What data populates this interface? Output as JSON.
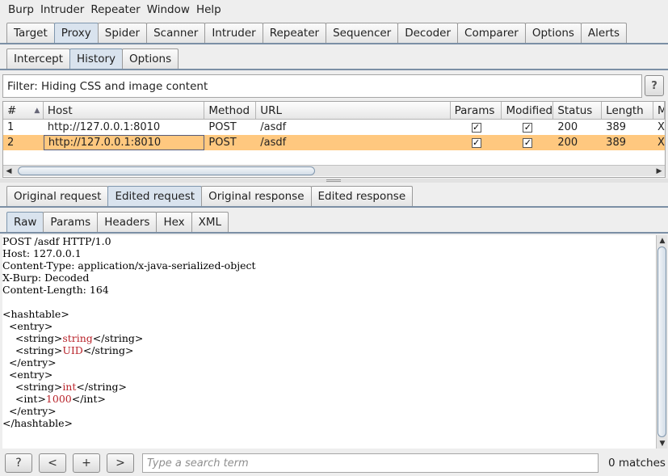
{
  "menu": [
    "Burp",
    "Intruder",
    "Repeater",
    "Window",
    "Help"
  ],
  "main_tabs": [
    "Target",
    "Proxy",
    "Spider",
    "Scanner",
    "Intruder",
    "Repeater",
    "Sequencer",
    "Decoder",
    "Comparer",
    "Options",
    "Alerts"
  ],
  "main_tabs_active": "Proxy",
  "proxy_tabs": [
    "Intercept",
    "History",
    "Options"
  ],
  "proxy_tabs_active": "History",
  "filter": {
    "text": "Filter: Hiding CSS and image content",
    "help_label": "?"
  },
  "table": {
    "columns": [
      "#",
      "Host",
      "Method",
      "URL",
      "Params",
      "Modified",
      "Status",
      "Length",
      "M"
    ],
    "sort_indicator": "▲",
    "rows": [
      {
        "num": "1",
        "host": "http://127.0.0.1:8010",
        "method": "POST",
        "url": "/asdf",
        "params": true,
        "modified": true,
        "status": "200",
        "length": "389",
        "extra": "X"
      },
      {
        "num": "2",
        "host": "http://127.0.0.1:8010",
        "method": "POST",
        "url": "/asdf",
        "params": true,
        "modified": true,
        "status": "200",
        "length": "389",
        "extra": "X"
      }
    ],
    "selected_row": 1,
    "scroll_left_arrow": "◀",
    "scroll_right_arrow": "▶"
  },
  "message_tabs": [
    "Original request",
    "Edited request",
    "Original response",
    "Edited response"
  ],
  "message_tabs_active": "Edited request",
  "view_tabs": [
    "Raw",
    "Params",
    "Headers",
    "Hex",
    "XML"
  ],
  "view_tabs_active": "Raw",
  "editor": {
    "lines": [
      [
        {
          "t": "POST /asdf HTTP/1.0"
        }
      ],
      [
        {
          "t": "Host: 127.0.0.1"
        }
      ],
      [
        {
          "t": "Content-Type: application/x-java-serialized-object"
        }
      ],
      [
        {
          "t": "X-Burp: Decoded"
        }
      ],
      [
        {
          "t": "Content-Length: 164"
        }
      ],
      [
        {
          "t": ""
        }
      ],
      [
        {
          "t": "<hashtable>"
        }
      ],
      [
        {
          "t": "  <entry>"
        }
      ],
      [
        {
          "t": "    <string>"
        },
        {
          "t": "string",
          "red": true
        },
        {
          "t": "</string>"
        }
      ],
      [
        {
          "t": "    <string>"
        },
        {
          "t": "UID",
          "red": true
        },
        {
          "t": "</string>"
        }
      ],
      [
        {
          "t": "  </entry>"
        }
      ],
      [
        {
          "t": "  <entry>"
        }
      ],
      [
        {
          "t": "    <string>"
        },
        {
          "t": "int",
          "red": true
        },
        {
          "t": "</string>"
        }
      ],
      [
        {
          "t": "    <int>"
        },
        {
          "t": "1000",
          "red": true
        },
        {
          "t": "</int>"
        }
      ],
      [
        {
          "t": "  </entry>"
        }
      ],
      [
        {
          "t": "</hashtable>"
        }
      ]
    ],
    "scroll_up_arrow": "▲",
    "scroll_down_arrow": "▼"
  },
  "search": {
    "help_label": "?",
    "prev_label": "<",
    "add_label": "+",
    "next_label": ">",
    "placeholder": "Type a search term",
    "matches": "0 matches"
  },
  "colors": {
    "selected_row": "#ffc87f",
    "active_tab": "#d9e3ee",
    "highlight_value": "#b8232a"
  }
}
